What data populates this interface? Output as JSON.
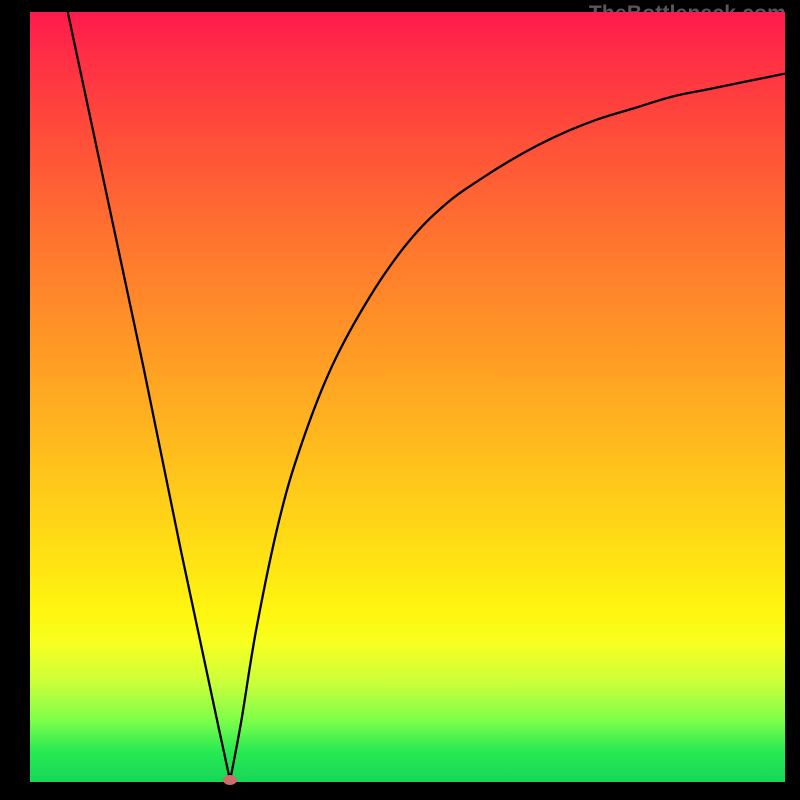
{
  "brand": {
    "label": "TheBottleneck.com"
  },
  "chart_data": {
    "type": "line",
    "title": "",
    "xlabel": "",
    "ylabel": "",
    "xlim": [
      0,
      100
    ],
    "ylim": [
      0,
      100
    ],
    "grid": false,
    "legend_position": "none",
    "vertex": {
      "x": 26.5,
      "y": 0.2
    },
    "series": [
      {
        "name": "left-branch",
        "x": [
          5,
          10,
          15,
          20,
          25,
          26.5
        ],
        "y": [
          100,
          77,
          54,
          30,
          7,
          0.2
        ]
      },
      {
        "name": "right-branch",
        "x": [
          26.5,
          28,
          30,
          33,
          36,
          40,
          45,
          50,
          55,
          60,
          65,
          70,
          75,
          80,
          85,
          90,
          95,
          100
        ],
        "y": [
          0.2,
          8,
          20,
          34,
          44,
          54,
          63,
          70,
          75,
          78.5,
          81.5,
          84,
          86,
          87.5,
          89,
          90,
          91,
          92
        ]
      }
    ],
    "background_gradient": {
      "top_color": "#ff1a4d",
      "mid_color": "#ffe214",
      "bottom_color": "#18d658"
    },
    "vertex_marker": {
      "color": "#d16a6a",
      "shape": "ellipse"
    }
  }
}
